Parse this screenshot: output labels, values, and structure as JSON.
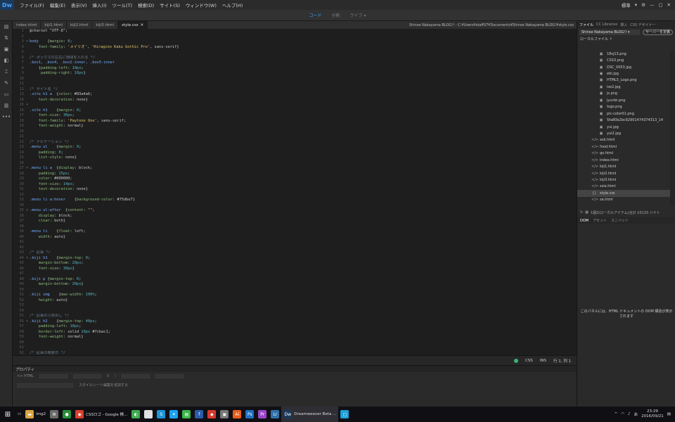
{
  "app": {
    "logo": "Dw"
  },
  "menu": {
    "items": [
      "ファイル(F)",
      "編集(E)",
      "表示(V)",
      "挿入(I)",
      "ツール(T)",
      "検索(D)",
      "サイト(S)",
      "ウィンドウ(W)",
      "ヘルプ(H)"
    ],
    "workspace": "標準"
  },
  "viewbar": {
    "code": "コード",
    "split": "分割",
    "live": "ライブ"
  },
  "tabs": [
    {
      "label": "index.html",
      "active": false
    },
    {
      "label": "kiji1.html",
      "active": false
    },
    {
      "label": "kiji2.html",
      "active": false
    },
    {
      "label": "kiji3.html",
      "active": false
    },
    {
      "label": "style.css",
      "active": true
    }
  ],
  "filepath": "Shinse Nakayama BLOG!! - C:¥Users¥staff07¥Documents¥Shinse Nakayama BLOG!¥style.css",
  "code_lines": [
    [
      [
        "p",
        "@charset \"UTF-8\";"
      ]
    ],
    [],
    [
      [
        "sel",
        "body"
      ],
      [
        "p",
        "    {"
      ],
      [
        "pr",
        "margin"
      ],
      [
        "p",
        ": "
      ],
      [
        "n",
        "0"
      ],
      [
        "p",
        ";"
      ]
    ],
    [
      [
        "p",
        "    "
      ],
      [
        "pr",
        "font-family"
      ],
      [
        "p",
        ": "
      ],
      [
        "s",
        "'メイリオ'"
      ],
      [
        "p",
        ", "
      ],
      [
        "s",
        "'Hiragino Kaku Gothic Pro'"
      ],
      [
        "p",
        ", sans-serif}"
      ]
    ],
    [],
    [
      [
        "c",
        "/* ボックスの左右に隙間を入れる */"
      ]
    ],
    [
      [
        "sel",
        ".box1, .box4, .box2-inner, .box5-inner"
      ]
    ],
    [
      [
        "p",
        "    {"
      ],
      [
        "pr",
        "padding-left"
      ],
      [
        "p",
        ": "
      ],
      [
        "n",
        "10px"
      ],
      [
        "p",
        ";"
      ]
    ],
    [
      [
        "p",
        "     "
      ],
      [
        "pr",
        "padding-right"
      ],
      [
        "p",
        ": "
      ],
      [
        "n",
        "10px"
      ],
      [
        "p",
        "}"
      ]
    ],
    [],
    [],
    [
      [
        "c",
        "/* サイト名 */"
      ]
    ],
    [
      [
        "sel",
        ".site h1 a"
      ],
      [
        "p",
        "  {"
      ],
      [
        "pr",
        "color"
      ],
      [
        "p",
        ": #83a4a6;"
      ]
    ],
    [
      [
        "p",
        "    "
      ],
      [
        "pr",
        "text-decoration"
      ],
      [
        "p",
        ": none}"
      ]
    ],
    [],
    [
      [
        "sel",
        ".site h1"
      ],
      [
        "p",
        "    {"
      ],
      [
        "pr",
        "margin"
      ],
      [
        "p",
        ": "
      ],
      [
        "n",
        "0"
      ],
      [
        "p",
        ";"
      ]
    ],
    [
      [
        "p",
        "    "
      ],
      [
        "pr",
        "font-size"
      ],
      [
        "p",
        ": "
      ],
      [
        "n",
        "30px"
      ],
      [
        "p",
        ";"
      ]
    ],
    [
      [
        "p",
        "    "
      ],
      [
        "pr",
        "font-family"
      ],
      [
        "p",
        ": "
      ],
      [
        "s",
        "'Paytone One'"
      ],
      [
        "p",
        ", sans-serif;"
      ]
    ],
    [
      [
        "p",
        "    "
      ],
      [
        "pr",
        "font-weight"
      ],
      [
        "p",
        ": normal}"
      ]
    ],
    [],
    [],
    [
      [
        "c",
        "/* ナビゲーション */"
      ]
    ],
    [
      [
        "sel",
        ".menu ul"
      ],
      [
        "p",
        "    {"
      ],
      [
        "pr",
        "margin"
      ],
      [
        "p",
        ": "
      ],
      [
        "n",
        "0"
      ],
      [
        "p",
        ";"
      ]
    ],
    [
      [
        "p",
        "    "
      ],
      [
        "pr",
        "padding"
      ],
      [
        "p",
        ": "
      ],
      [
        "n",
        "0"
      ],
      [
        "p",
        ";"
      ]
    ],
    [
      [
        "p",
        "    "
      ],
      [
        "pr",
        "list-style"
      ],
      [
        "p",
        ": none}"
      ]
    ],
    [],
    [
      [
        "sel",
        ".menu li a"
      ],
      [
        "p",
        "  {"
      ],
      [
        "pr",
        "display"
      ],
      [
        "p",
        ": block;"
      ]
    ],
    [
      [
        "p",
        "    "
      ],
      [
        "pr",
        "padding"
      ],
      [
        "p",
        ": "
      ],
      [
        "n",
        "15px"
      ],
      [
        "p",
        ";"
      ]
    ],
    [
      [
        "p",
        "    "
      ],
      [
        "pr",
        "color"
      ],
      [
        "p",
        ": #000000;"
      ]
    ],
    [
      [
        "p",
        "    "
      ],
      [
        "pr",
        "font-size"
      ],
      [
        "p",
        ": "
      ],
      [
        "n",
        "14px"
      ],
      [
        "p",
        ";"
      ]
    ],
    [
      [
        "p",
        "    "
      ],
      [
        "pr",
        "text-decoration"
      ],
      [
        "p",
        ": none}"
      ]
    ],
    [],
    [
      [
        "sel",
        ".menu li a:hover"
      ],
      [
        "p",
        "    {"
      ],
      [
        "pr",
        "background-color"
      ],
      [
        "p",
        ": #75dbe7}"
      ]
    ],
    [],
    [
      [
        "sel",
        ".menu ul:after"
      ],
      [
        "p",
        "  {"
      ],
      [
        "pr",
        "content"
      ],
      [
        "p",
        ": "
      ],
      [
        "s",
        "\"\""
      ],
      [
        "p",
        ";"
      ]
    ],
    [
      [
        "p",
        "    "
      ],
      [
        "pr",
        "display"
      ],
      [
        "p",
        ": block;"
      ]
    ],
    [
      [
        "p",
        "    "
      ],
      [
        "pr",
        "clear"
      ],
      [
        "p",
        ": both}"
      ]
    ],
    [],
    [
      [
        "sel",
        ".menu li"
      ],
      [
        "p",
        "    {"
      ],
      [
        "pr",
        "float"
      ],
      [
        "p",
        ": left;"
      ]
    ],
    [
      [
        "p",
        "    "
      ],
      [
        "pr",
        "width"
      ],
      [
        "p",
        ": auto}"
      ]
    ],
    [],
    [],
    [
      [
        "c",
        "/* 記事 */"
      ]
    ],
    [
      [
        "sel",
        ".kiji h1"
      ],
      [
        "p",
        "    {"
      ],
      [
        "pr",
        "margin-top"
      ],
      [
        "p",
        ": "
      ],
      [
        "n",
        "0"
      ],
      [
        "p",
        ";"
      ]
    ],
    [
      [
        "p",
        "    "
      ],
      [
        "pr",
        "margin-bottom"
      ],
      [
        "p",
        ": "
      ],
      [
        "n",
        "20px"
      ],
      [
        "p",
        ";"
      ]
    ],
    [
      [
        "p",
        "    "
      ],
      [
        "pr",
        "font-size"
      ],
      [
        "p",
        ": "
      ],
      [
        "n",
        "30px"
      ],
      [
        "p",
        "}"
      ]
    ],
    [],
    [
      [
        "sel",
        ".kiji p"
      ],
      [
        "p",
        " {"
      ],
      [
        "pr",
        "margin-top"
      ],
      [
        "p",
        ": "
      ],
      [
        "n",
        "0"
      ],
      [
        "p",
        ";"
      ]
    ],
    [
      [
        "p",
        "    "
      ],
      [
        "pr",
        "margin-bottom"
      ],
      [
        "p",
        ": "
      ],
      [
        "n",
        "20px"
      ],
      [
        "p",
        "}"
      ]
    ],
    [],
    [
      [
        "sel",
        ".kiji img"
      ],
      [
        "p",
        "    {"
      ],
      [
        "pr",
        "max-width"
      ],
      [
        "p",
        ": "
      ],
      [
        "n",
        "100%"
      ],
      [
        "p",
        ";"
      ]
    ],
    [
      [
        "p",
        "    "
      ],
      [
        "pr",
        "height"
      ],
      [
        "p",
        ": auto}"
      ]
    ],
    [],
    [],
    [
      [
        "c",
        "/* 記事の小見出し */"
      ]
    ],
    [
      [
        "sel",
        ".kiji h2"
      ],
      [
        "p",
        "    {"
      ],
      [
        "pr",
        "margin-top"
      ],
      [
        "p",
        ": "
      ],
      [
        "n",
        "40px"
      ],
      [
        "p",
        ";"
      ]
    ],
    [
      [
        "p",
        "    "
      ],
      [
        "pr",
        "padding-left"
      ],
      [
        "p",
        ": "
      ],
      [
        "n",
        "10px"
      ],
      [
        "p",
        ";"
      ]
    ],
    [
      [
        "p",
        "    "
      ],
      [
        "pr",
        "border-left"
      ],
      [
        "p",
        ": solid "
      ],
      [
        "n",
        "10px"
      ],
      [
        "p",
        " #7cbac1;"
      ]
    ],
    [
      [
        "p",
        "    "
      ],
      [
        "pr",
        "font-weight"
      ],
      [
        "p",
        ": normal}"
      ]
    ],
    [],
    [],
    [
      [
        "c",
        "/* 記事の概要日 */"
      ]
    ]
  ],
  "fold_lines": [
    3,
    15,
    27,
    35,
    44,
    56
  ],
  "statusbar": {
    "mode": "CSS",
    "ins": "INS",
    "position": "行 1, 列 1"
  },
  "props": {
    "title": "プロパティ",
    "tag": "<> HTML",
    "hint": "スタイルシート編集を追加する"
  },
  "right": {
    "tabs": [
      {
        "label": "ファイル",
        "active": true
      },
      {
        "label": "CC Libraries",
        "active": false
      },
      {
        "label": "挿入",
        "active": false
      },
      {
        "label": "CSS デザイナー",
        "active": false
      }
    ],
    "site": "Shinse Nakayama BLOG!!",
    "server_button": "サーバーを定義",
    "local": "ローカルファイル ↑",
    "files": [
      {
        "name": "18sj13.png",
        "icon": "img"
      },
      {
        "name": "CSS3.png",
        "icon": "img"
      },
      {
        "name": "DSC_0053.jpg",
        "icon": "img"
      },
      {
        "name": "ebi.jpg",
        "icon": "img"
      },
      {
        "name": "HTML5_Logo.png",
        "icon": "img"
      },
      {
        "name": "ise2.jpg",
        "icon": "img"
      },
      {
        "name": "js.png",
        "icon": "img"
      },
      {
        "name": "jyunbi.png",
        "icon": "img"
      },
      {
        "name": "logo.png",
        "icon": "img"
      },
      {
        "name": "pic-color01.png",
        "icon": "img"
      },
      {
        "name": "5fa80b2bc92901474374313_14",
        "icon": "img"
      },
      {
        "name": "yui.jpg",
        "icon": "img"
      },
      {
        "name": "yui2.jpg",
        "icon": "img"
      },
      {
        "name": "ask.html",
        "icon": "code"
      },
      {
        "name": "food.html",
        "icon": "code"
      },
      {
        "name": "go.html",
        "icon": "code"
      },
      {
        "name": "index.html",
        "icon": "code"
      },
      {
        "name": "kiji1.html",
        "icon": "code"
      },
      {
        "name": "kiji2.html",
        "icon": "code"
      },
      {
        "name": "kiji3.html",
        "icon": "code"
      },
      {
        "name": "ssie.html",
        "icon": "code"
      },
      {
        "name": "style.css",
        "icon": "css",
        "selected": true
      },
      {
        "name": "za.html",
        "icon": "code"
      }
    ],
    "summary": "1個のローカルアイテム(合計 10133 バイト",
    "dom_tabs": [
      "DOM",
      "アセット",
      "スニペット"
    ],
    "dom_message": "このパネルには、HTML ドキュメントの DOM 構造が表示されます"
  },
  "taskbar": {
    "apps": [
      {
        "label": "img2",
        "color": "#d9a441",
        "glyph": "▬",
        "active": false
      },
      {
        "label": "",
        "color": "#6a6a6a",
        "glyph": "⚙",
        "active": false
      },
      {
        "label": "",
        "color": "#2a8f3a",
        "glyph": "●",
        "active": false
      },
      {
        "label": "CSSロゴ - Google 検...",
        "color": "#d93f2c",
        "glyph": "◉",
        "active": false
      },
      {
        "label": "",
        "color": "#3dab4f",
        "glyph": "◐",
        "active": false
      },
      {
        "label": "",
        "color": "#e0e0e0",
        "glyph": "◌",
        "active": false
      },
      {
        "label": "",
        "color": "#1b95d6",
        "glyph": "S",
        "active": false
      },
      {
        "label": "",
        "color": "#1da1f2",
        "glyph": "✦",
        "active": false
      },
      {
        "label": "",
        "color": "#3cb64a",
        "glyph": "▤",
        "active": false
      },
      {
        "label": "",
        "color": "#2b5cab",
        "glyph": "f",
        "active": false
      },
      {
        "label": "",
        "color": "#d43b2e",
        "glyph": "◆",
        "active": false
      },
      {
        "label": "",
        "color": "#777777",
        "glyph": "▣",
        "active": false
      },
      {
        "label": "",
        "color": "#e85d1b",
        "glyph": "Ai",
        "active": false
      },
      {
        "label": "",
        "color": "#1f6fc2",
        "glyph": "Ps",
        "active": false
      },
      {
        "label": "",
        "color": "#9b45c9",
        "glyph": "Pr",
        "active": false
      },
      {
        "label": "",
        "color": "#2f6fa8",
        "glyph": "Lr",
        "active": false
      },
      {
        "label": "Dreamweaver Beta ...",
        "color": "#1b3a5c",
        "glyph": "Dw",
        "active": true
      },
      {
        "label": "",
        "color": "#1ea0d8",
        "glyph": "□",
        "active": false
      }
    ],
    "time": "23:29",
    "date": "2016/09/21"
  }
}
